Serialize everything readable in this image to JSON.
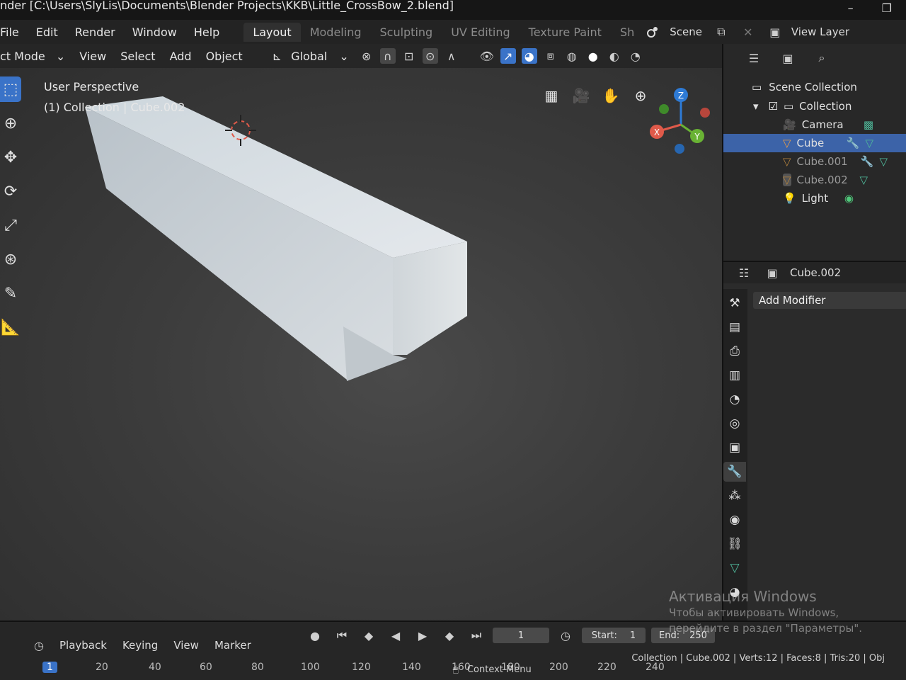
{
  "titlebar": {
    "title": "nder  [C:\\Users\\SlyLis\\Documents\\Blender Projects\\KKB\\Little_CrossBow_2.blend]",
    "minimize": "–",
    "maximize": "❐"
  },
  "menu": [
    "File",
    "Edit",
    "Render",
    "Window",
    "Help"
  ],
  "workspaces": [
    "Layout",
    "Modeling",
    "Sculpting",
    "UV Editing",
    "Texture Paint",
    "Sh"
  ],
  "scene": {
    "label": "Scene"
  },
  "view_layer": {
    "label": "View Layer"
  },
  "viewport_header": {
    "mode": "ct Mode",
    "items": [
      "View",
      "Select",
      "Add",
      "Object"
    ],
    "transform": "Global"
  },
  "viewport": {
    "perspective": "User Perspective",
    "collection_info": "(1) Collection | Cube.002"
  },
  "outliner": {
    "root": "Scene Collection",
    "collection": "Collection",
    "items": [
      {
        "name": "Camera",
        "type": "camera"
      },
      {
        "name": "Cube",
        "type": "mesh",
        "selected": true
      },
      {
        "name": "Cube.001",
        "type": "mesh"
      },
      {
        "name": "Cube.002",
        "type": "mesh"
      },
      {
        "name": "Light",
        "type": "light"
      }
    ]
  },
  "properties": {
    "object_name": "Cube.002",
    "add_modifier": "Add Modifier"
  },
  "timeline": {
    "items": [
      "Playback",
      "Keying",
      "View",
      "Marker"
    ],
    "current_frame": "1",
    "start_label": "Start:",
    "start_value": "1",
    "end_label": "End:",
    "end_value": "250",
    "ruler": [
      "1",
      "20",
      "40",
      "60",
      "80",
      "100",
      "120",
      "140",
      "160",
      "180",
      "200",
      "220",
      "240"
    ],
    "context_menu": "Context Menu",
    "stats": "Collection | Cube.002 | Verts:12 | Faces:8 | Tris:20 | Obj"
  },
  "activation": {
    "line1": "Активация Windows",
    "line2": "Чтобы активировать Windows,",
    "line3": "перейдите в раздел \"Параметры\"."
  },
  "colors": {
    "accent": "#3a73c8",
    "selection": "#3c63a8",
    "viewport_bg": "#3c3c3c",
    "cursor_red": "#e05a4a"
  }
}
